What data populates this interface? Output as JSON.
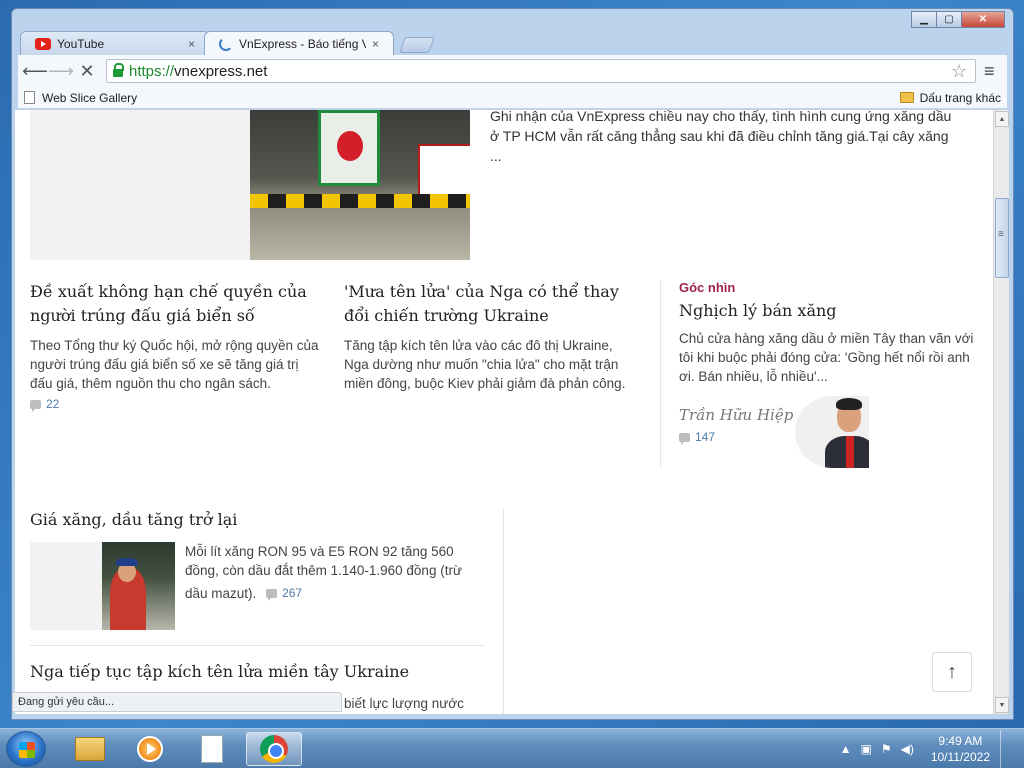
{
  "window": {
    "tabs": [
      {
        "title": "YouTube",
        "icon": "youtube-icon"
      },
      {
        "title": "VnExpress - Báo tiếng Việt",
        "icon": "loading-spinner-icon"
      }
    ],
    "tab_close_glyph": "×"
  },
  "toolbar": {
    "url_scheme": "https://",
    "url_host": "vnexpress.net"
  },
  "bookmarks": {
    "left": "Web Slice Gallery",
    "right": "Dấu trang khác"
  },
  "page": {
    "lead_snippet": "Ghi nhận của VnExpress chiều nay cho thấy, tình hình cung ứng xăng dầu ở TP HCM vẫn rất căng thẳng sau khi đã điều chỉnh tăng giá.Tại cây xăng ...",
    "articles": [
      {
        "title": "Đề xuất không hạn chế quyền của người trúng đấu giá biển số",
        "desc": "Theo Tổng thư ký Quốc hội, mở rộng quyền của người trúng đấu giá biển số xe sẽ tăng giá trị đấu giá, thêm nguồn thu cho ngân sách.",
        "comments": "22"
      },
      {
        "title": "'Mưa tên lửa' của Nga có thể thay đổi chiến trường Ukraine",
        "desc": "Tăng tập kích tên lửa vào các đô thị Ukraine, Nga dường như muốn \"chia lửa\" cho mặt trận miền đông, buộc Kiev phải giảm đà phản công."
      }
    ],
    "opinion": {
      "label": "Góc nhìn",
      "title": "Nghịch lý bán xăng",
      "desc": "Chủ cửa hàng xăng dầu ở miền Tây than vãn với tôi khi buộc phải đóng cửa: 'Gồng hết nổi rồi anh ơi. Bán nhiều, lỗ nhiều'...",
      "author": "Trần Hữu Hiệp",
      "comments": "147"
    },
    "fuel_article": {
      "title": "Giá xăng, dầu tăng trở lại",
      "desc": "Mỗi lít xăng RON 95 và E5 RON 92 tăng 560 đồng, còn dầu đắt thêm 1.140-1.960 đồng (trừ dầu mazut).",
      "comments": "267"
    },
    "bottom_article": {
      "title": "Nga tiếp tục tập kích tên lửa miền tây Ukraine",
      "desc_fragment": "biết lực lượng nước"
    },
    "scroll_top_glyph": "↑"
  },
  "status_text": "Đang gửi yêu cầu...",
  "taskbar": {
    "apps": [
      "windows-explorer-icon",
      "media-player-icon",
      "document-icon",
      "chrome-icon"
    ],
    "clock_time": "9:49 AM",
    "clock_date": "10/11/2022"
  }
}
